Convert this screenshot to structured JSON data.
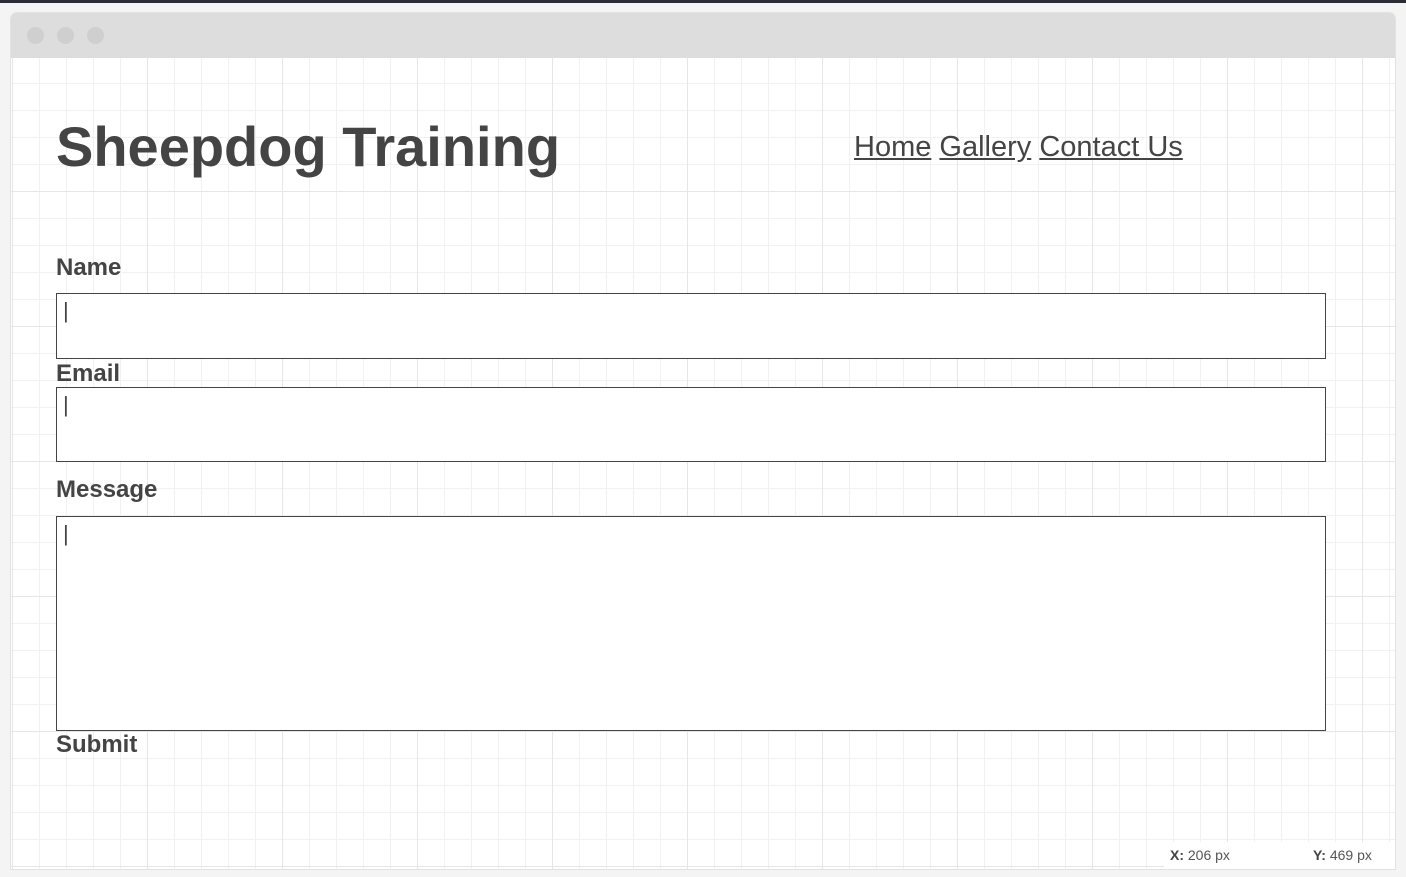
{
  "site": {
    "title": "Sheepdog Training"
  },
  "nav": {
    "items": [
      "Home",
      "Gallery",
      "Contact Us"
    ]
  },
  "form": {
    "name_label": "Name",
    "name_value": "|",
    "email_label": "Email",
    "email_value": "|",
    "message_label": "Message",
    "message_value": "|",
    "submit_label": "Submit"
  },
  "coords": {
    "x_label": "X:",
    "x_value": "206 px",
    "y_label": "Y:",
    "y_value": "469 px"
  },
  "colors": {
    "text": "#444444",
    "titlebar": "#dddddd",
    "grid": "#e6e6e6"
  }
}
